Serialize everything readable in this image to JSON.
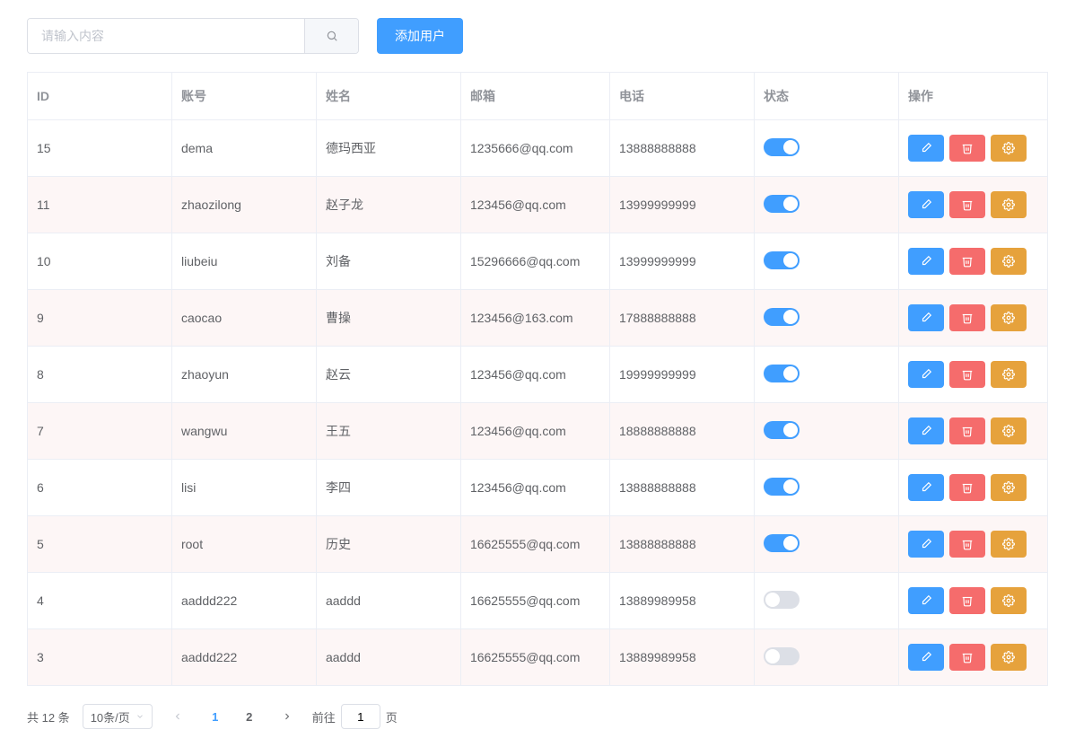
{
  "search": {
    "placeholder": "请输入内容"
  },
  "toolbar": {
    "add_user": "添加用户"
  },
  "columns": {
    "id": "ID",
    "account": "账号",
    "name": "姓名",
    "email": "邮箱",
    "phone": "电话",
    "status": "状态",
    "action": "操作"
  },
  "rows": [
    {
      "id": "15",
      "account": "dema",
      "name": "德玛西亚",
      "email": "1235666@qq.com",
      "phone": "13888888888",
      "status": true
    },
    {
      "id": "11",
      "account": "zhaozilong",
      "name": "赵子龙",
      "email": "123456@qq.com",
      "phone": "13999999999",
      "status": true
    },
    {
      "id": "10",
      "account": "liubeiu",
      "name": "刘备",
      "email": "15296666@qq.com",
      "phone": "13999999999",
      "status": true
    },
    {
      "id": "9",
      "account": "caocao",
      "name": "曹操",
      "email": "123456@163.com",
      "phone": "17888888888",
      "status": true
    },
    {
      "id": "8",
      "account": "zhaoyun",
      "name": "赵云",
      "email": "123456@qq.com",
      "phone": "19999999999",
      "status": true
    },
    {
      "id": "7",
      "account": "wangwu",
      "name": "王五",
      "email": "123456@qq.com",
      "phone": "18888888888",
      "status": true
    },
    {
      "id": "6",
      "account": "lisi",
      "name": "李四",
      "email": "123456@qq.com",
      "phone": "13888888888",
      "status": true
    },
    {
      "id": "5",
      "account": "root",
      "name": "历史",
      "email": "16625555@qq.com",
      "phone": "13888888888",
      "status": true
    },
    {
      "id": "4",
      "account": "aaddd222",
      "name": "aaddd",
      "email": "16625555@qq.com",
      "phone": "13889989958",
      "status": false
    },
    {
      "id": "3",
      "account": "aaddd222",
      "name": "aaddd",
      "email": "16625555@qq.com",
      "phone": "13889989958",
      "status": false
    }
  ],
  "pagination": {
    "total_label": "共 12 条",
    "page_size": "10条/页",
    "pages": [
      "1",
      "2"
    ],
    "current": 1,
    "jump_prefix": "前往",
    "jump_value": "1",
    "jump_suffix": "页"
  }
}
